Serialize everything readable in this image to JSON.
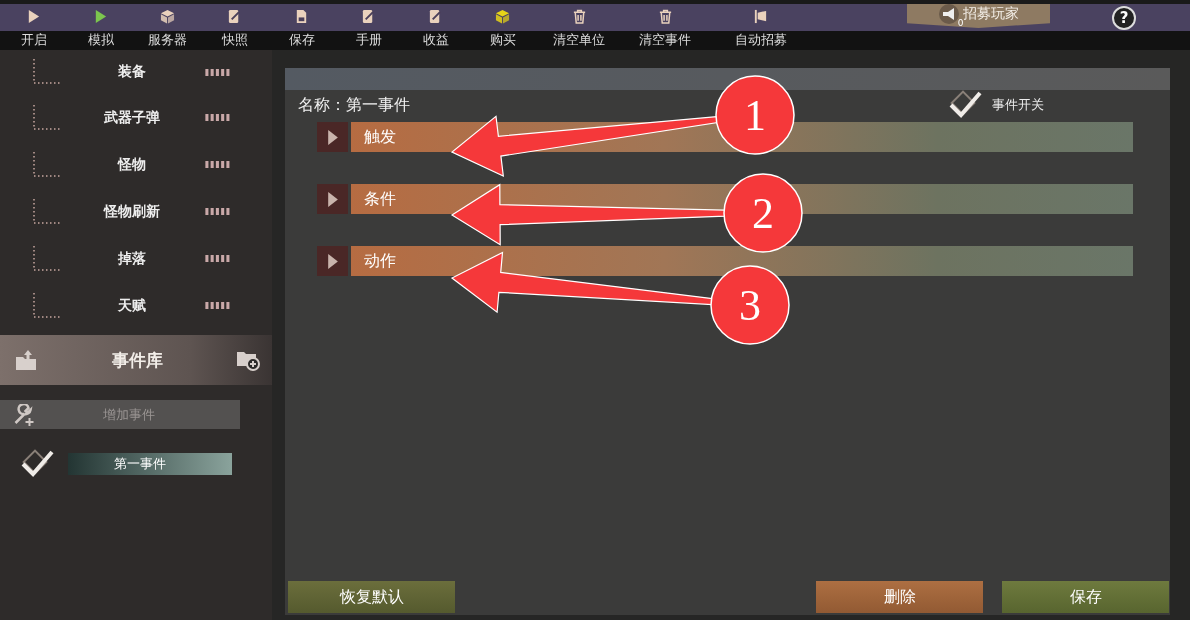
{
  "toolbar": [
    {
      "label": "开启",
      "kind": "play",
      "color": "#ead2bd"
    },
    {
      "label": "模拟",
      "kind": "play",
      "color": "#7cc64e"
    },
    {
      "label": "服务器",
      "kind": "cube",
      "color": "#ead2bd"
    },
    {
      "label": "快照",
      "kind": "note",
      "color": "#ead2bd"
    },
    {
      "label": "保存",
      "kind": "doc",
      "color": "#ead2bd"
    },
    {
      "label": "手册",
      "kind": "note",
      "color": "#ead2bd"
    },
    {
      "label": "收益",
      "kind": "note",
      "color": "#ead2bd"
    },
    {
      "label": "购买",
      "kind": "cube",
      "color": "#e6d417"
    },
    {
      "label": "清空单位",
      "kind": "trash",
      "color": "#ead2bd"
    },
    {
      "label": "清空事件",
      "kind": "trash",
      "color": "#ead2bd"
    },
    {
      "label": "自动招募",
      "kind": "flag",
      "color": "#ead2bd"
    }
  ],
  "recruit": {
    "label": "招募玩家",
    "badge": "0"
  },
  "help": {
    "label": "?"
  },
  "sidebar": {
    "items": [
      {
        "label": "装备"
      },
      {
        "label": "武器子弹"
      },
      {
        "label": "怪物"
      },
      {
        "label": "怪物刷新"
      },
      {
        "label": "掉落"
      },
      {
        "label": "天赋"
      }
    ],
    "library": {
      "title": "事件库"
    },
    "add_button": {
      "label": "增加事件",
      "disabled": true
    },
    "events": [
      {
        "label": "第一事件",
        "checked": true,
        "selected": true
      }
    ]
  },
  "editor": {
    "name_label": "名称：第一事件",
    "toggle": {
      "label": "事件开关",
      "checked": true
    },
    "sections": [
      {
        "label": "触发",
        "expanded": false
      },
      {
        "label": "条件",
        "expanded": false
      },
      {
        "label": "动作",
        "expanded": false
      }
    ],
    "buttons": [
      {
        "label": "恢复默认",
        "kind": "secondary"
      },
      {
        "label": "删除",
        "kind": "danger"
      },
      {
        "label": "保存",
        "kind": "primary"
      }
    ]
  },
  "callouts": [
    {
      "label": "1"
    },
    {
      "label": "2"
    },
    {
      "label": "3"
    }
  ]
}
